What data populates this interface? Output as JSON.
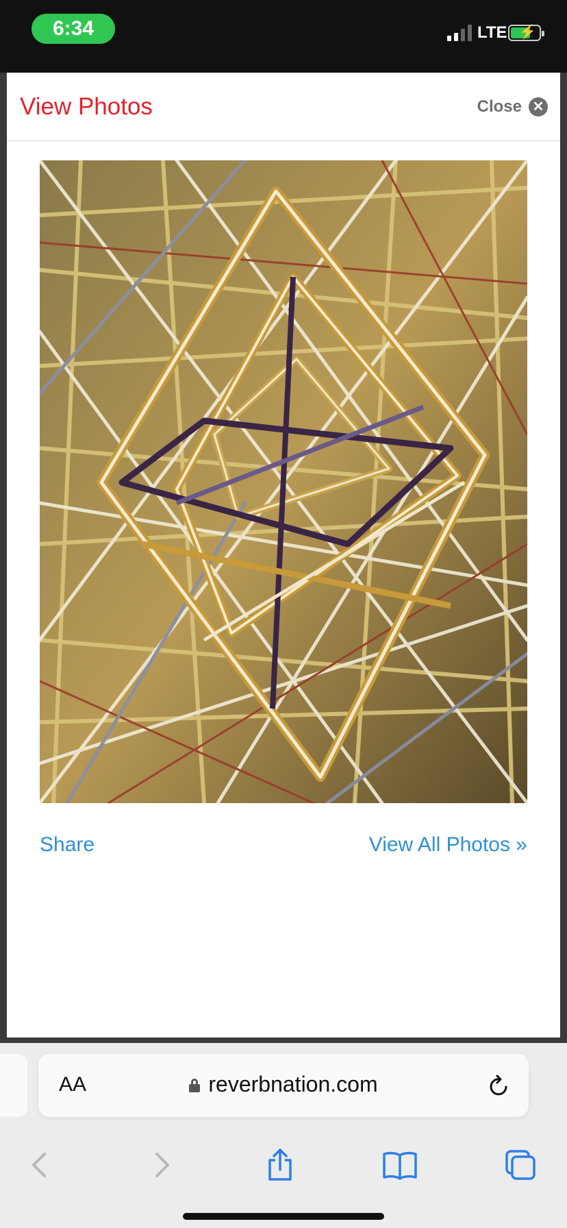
{
  "status_bar": {
    "time": "6:34",
    "network": "LTE"
  },
  "modal": {
    "title": "View Photos",
    "close_label": "Close",
    "photo_icon": "abstract-painting",
    "share_label": "Share",
    "view_all_label": "View All Photos »"
  },
  "browser": {
    "text_size_label": "AA",
    "url": "reverbnation.com",
    "toolbar_icons": [
      "back-icon",
      "forward-icon",
      "share-icon",
      "bookmarks-icon",
      "tabs-icon"
    ]
  },
  "colors": {
    "title_red": "#e8202a",
    "link_blue": "#2f8fd6",
    "status_green": "#30c652",
    "safari_blue": "#2f7ee6"
  }
}
